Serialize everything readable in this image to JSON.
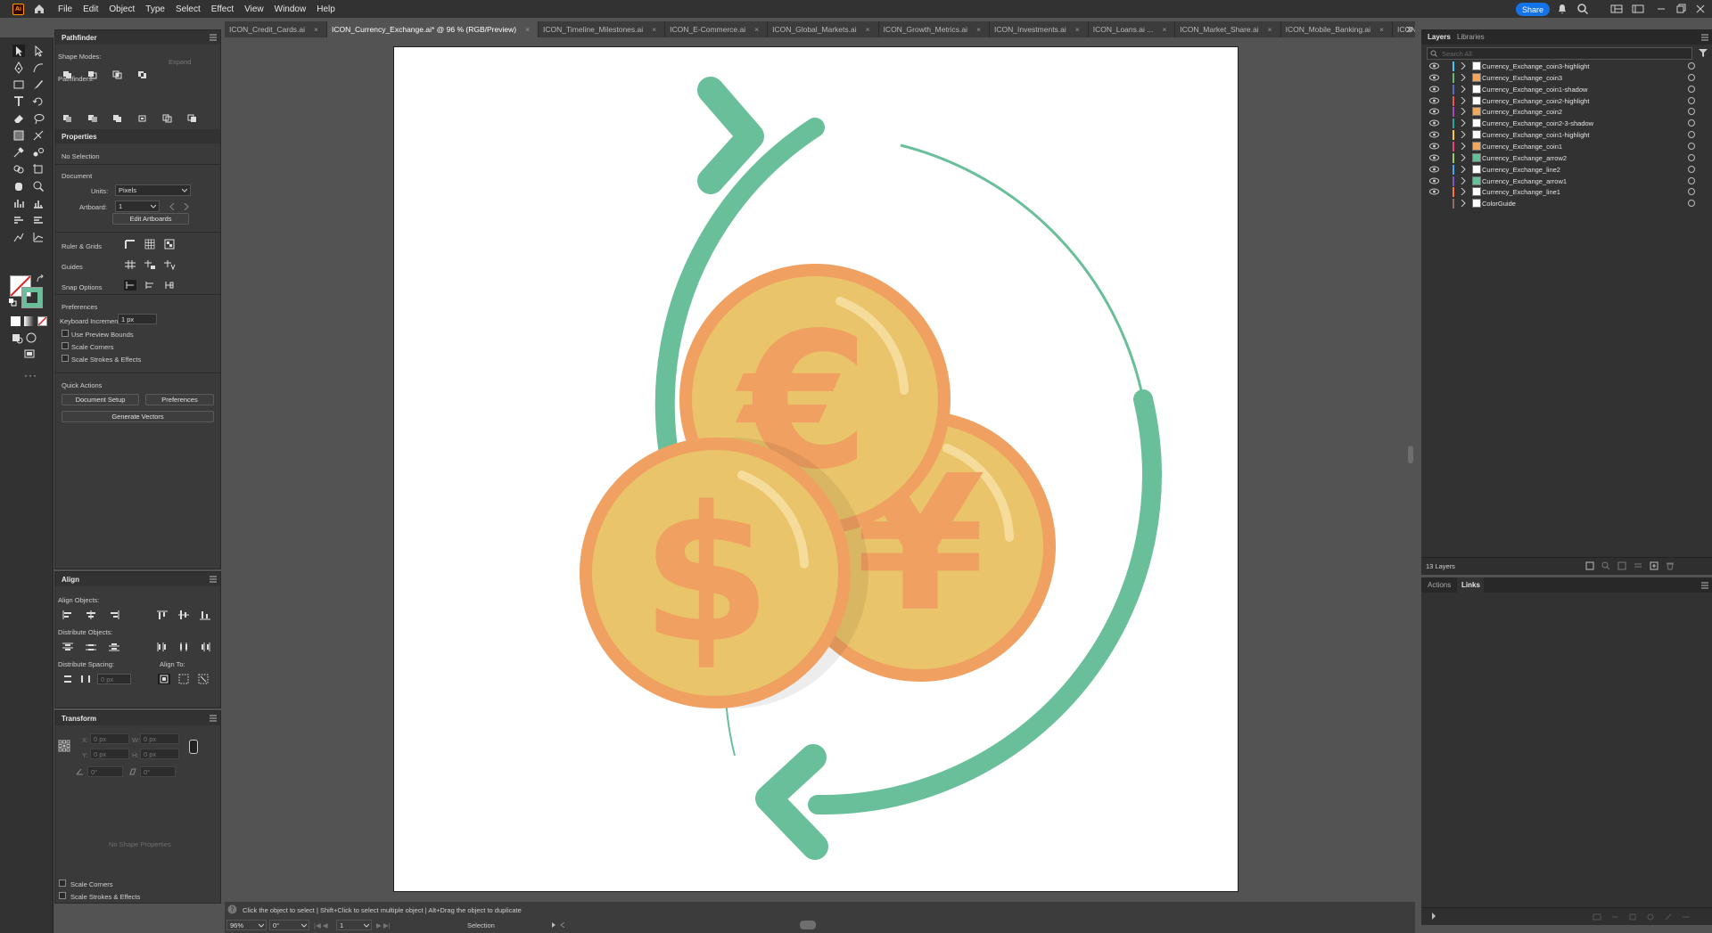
{
  "app": {
    "logo": "Ai",
    "menus": [
      "File",
      "Edit",
      "Object",
      "Type",
      "Select",
      "Effect",
      "View",
      "Window",
      "Help"
    ],
    "share_label": "Share"
  },
  "tabs": [
    {
      "label": "ICON_Credit_Cards.ai",
      "active": false
    },
    {
      "label": "ICON_Currency_Exchange.ai* @ 96 % (RGB/Preview)",
      "active": true
    },
    {
      "label": "ICON_Timeline_Milestones.ai",
      "active": false
    },
    {
      "label": "ICON_E-Commerce.ai",
      "active": false
    },
    {
      "label": "ICON_Global_Markets.ai",
      "active": false
    },
    {
      "label": "ICON_Growth_Metrics.ai",
      "active": false
    },
    {
      "label": "ICON_Investments.ai",
      "active": false
    },
    {
      "label": "ICON_Loans.ai ...",
      "active": false
    },
    {
      "label": "ICON_Market_Share.ai",
      "active": false
    },
    {
      "label": "ICON_Mobile_Banking.ai",
      "active": false
    },
    {
      "label": "ICON",
      "active": false
    }
  ],
  "pathfinder": {
    "tab": "Pathfinder",
    "shape_modes": "Shape Modes:",
    "expand": "Expand",
    "pathfinders": "Pathfinders:"
  },
  "properties": {
    "tab": "Properties",
    "no_selection": "No Selection",
    "document": "Document",
    "units_label": "Units:",
    "units_value": "Pixels",
    "artboard_label": "Artboard:",
    "artboard_value": "1",
    "edit_artboards": "Edit Artboards",
    "ruler_grids": "Ruler & Grids",
    "guides": "Guides",
    "snap_options": "Snap Options",
    "preferences_head": "Preferences",
    "keyboard_increment": "Keyboard Increment:",
    "keyboard_value": "1 px",
    "use_preview_bounds": "Use Preview Bounds",
    "scale_corners": "Scale Corners",
    "scale_strokes": "Scale Strokes & Effects",
    "quick_actions": "Quick Actions",
    "document_setup": "Document Setup",
    "preferences_btn": "Preferences",
    "generate_vectors": "Generate Vectors"
  },
  "align": {
    "tab": "Align",
    "align_objects": "Align Objects:",
    "distribute_objects": "Distribute Objects:",
    "distribute_spacing": "Distribute Spacing:",
    "align_to": "Align To:",
    "spacing_value": "0 px"
  },
  "transform": {
    "tab": "Transform",
    "x_label": "X:",
    "x_value": "0 px",
    "w_label": "W:",
    "w_value": "0 px",
    "y_label": "Y:",
    "y_value": "0 px",
    "h_label": "H:",
    "h_value": "0 px",
    "angle": "0°",
    "shear": "0°",
    "no_shape": "No Shape Properties",
    "scale_corners": "Scale Corners",
    "scale_strokes": "Scale Strokes & Effects"
  },
  "layers": {
    "tab_layers": "Layers",
    "tab_libraries": "Libraries",
    "search_placeholder": "Search All",
    "count": "13 Layers",
    "items": [
      {
        "name": "Currency_Exchange_coin3-highlight",
        "color": "#4fc3f7",
        "thumb": "#ffffff",
        "visible": true
      },
      {
        "name": "Currency_Exchange_coin3",
        "color": "#66bb6a",
        "thumb": "#f0a860",
        "visible": true
      },
      {
        "name": "Currency_Exchange_coin1-shadow",
        "color": "#5c6bc0",
        "thumb": "#ffffff",
        "visible": true
      },
      {
        "name": "Currency_Exchange_coin2-highlight",
        "color": "#ef5350",
        "thumb": "#ffffff",
        "visible": true
      },
      {
        "name": "Currency_Exchange_coin2",
        "color": "#ab47bc",
        "thumb": "#f0a860",
        "visible": true
      },
      {
        "name": "Currency_Exchange_coin2-3-shadow",
        "color": "#26a69a",
        "thumb": "#ffffff",
        "visible": true
      },
      {
        "name": "Currency_Exchange_coin1-highlight",
        "color": "#ffca28",
        "thumb": "#ffffff",
        "visible": true
      },
      {
        "name": "Currency_Exchange_coin1",
        "color": "#ec407a",
        "thumb": "#f0a860",
        "visible": true
      },
      {
        "name": "Currency_Exchange_arrow2",
        "color": "#9ccc65",
        "thumb": "#6abf9b",
        "visible": true
      },
      {
        "name": "Currency_Exchange_line2",
        "color": "#42a5f5",
        "thumb": "#ffffff",
        "visible": true
      },
      {
        "name": "Currency_Exchange_arrow1",
        "color": "#7e57c2",
        "thumb": "#6abf9b",
        "visible": true
      },
      {
        "name": "Currency_Exchange_line1",
        "color": "#ff7043",
        "thumb": "#ffffff",
        "visible": true
      },
      {
        "name": "ColorGuide",
        "color": "#8d6e63",
        "thumb": "#ffffff",
        "visible": false
      }
    ]
  },
  "actions": {
    "tab_actions": "Actions",
    "tab_links": "Links"
  },
  "status": {
    "hint": "Click the object to select  |  Shift+Click to select multiple object  |  Alt+Drag the object to duplicate",
    "zoom": "96%",
    "rotate": "0°",
    "artboard": "1",
    "tool": "Selection"
  },
  "artwork": {
    "coin_fill": "#e9c46a",
    "coin_ring": "#f0a060",
    "symbol_color": "#f0a060",
    "arrow_color": "#6abf9b",
    "symbols": [
      "€",
      "$",
      "¥"
    ]
  }
}
